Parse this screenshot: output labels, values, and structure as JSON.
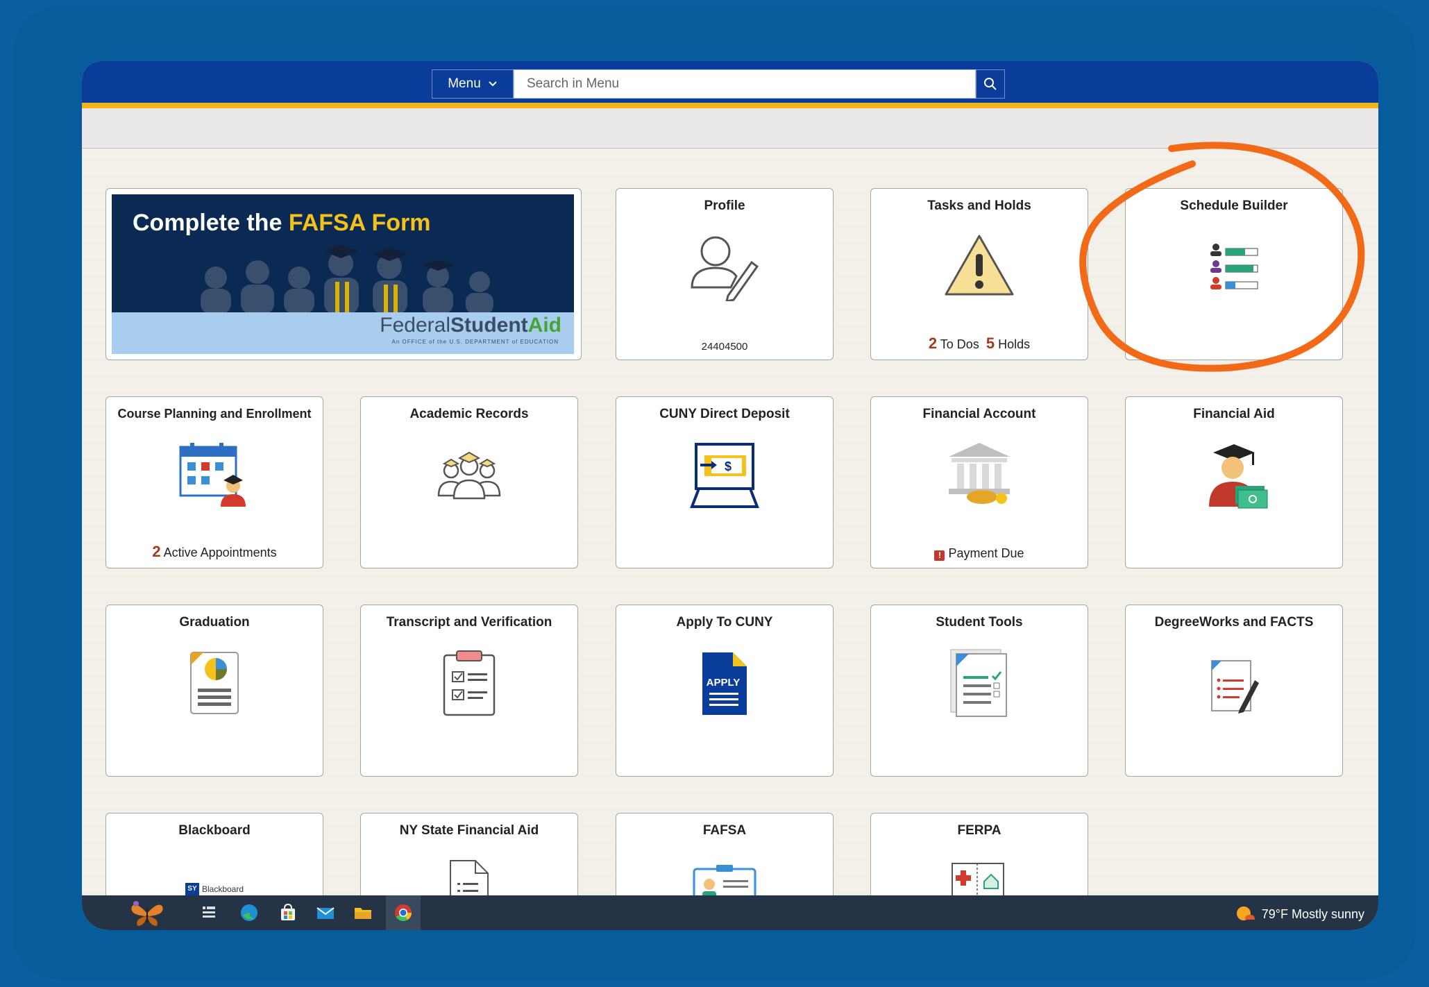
{
  "header": {
    "menu_label": "Menu",
    "search_placeholder": "Search in Menu"
  },
  "banner": {
    "headline_prefix": "Complete the ",
    "headline_highlight": "FAFSA Form",
    "brand_light": "Federal",
    "brand_bold": "Student",
    "brand_green": "Aid",
    "brand_sub": "An OFFICE of the U.S. DEPARTMENT of EDUCATION"
  },
  "tiles": {
    "profile": {
      "title": "Profile",
      "foot": "24404500",
      "icon": "user-edit-icon"
    },
    "tasks": {
      "title": "Tasks and Holds",
      "todos_count": "2",
      "todos_label": "To Dos",
      "holds_count": "5",
      "holds_label": "Holds",
      "icon": "warning-icon"
    },
    "schedule": {
      "title": "Schedule Builder",
      "icon": "schedule-list-icon"
    },
    "course": {
      "title": "Course Planning and Enrollment",
      "count": "2",
      "label": "Active Appointments",
      "icon": "calendar-student-icon"
    },
    "records": {
      "title": "Academic Records",
      "icon": "graduates-icon"
    },
    "deposit": {
      "title": "CUNY Direct Deposit",
      "icon": "laptop-deposit-icon"
    },
    "account": {
      "title": "Financial Account",
      "foot": "Payment Due",
      "icon": "bank-icon"
    },
    "aid": {
      "title": "Financial Aid",
      "icon": "graduate-money-icon"
    },
    "graduation": {
      "title": "Graduation",
      "icon": "report-chart-icon"
    },
    "transcript": {
      "title": "Transcript and Verification",
      "icon": "clipboard-check-icon"
    },
    "apply": {
      "title": "Apply To CUNY",
      "doc_text": "APPLY",
      "icon": "apply-document-icon"
    },
    "tools": {
      "title": "Student Tools",
      "icon": "checklist-document-icon"
    },
    "degreeworks": {
      "title": "DegreeWorks and FACTS",
      "icon": "document-pen-icon"
    },
    "blackboard": {
      "title": "Blackboard",
      "logo_text": "Blackboard",
      "icon": "blackboard-logo-icon"
    },
    "nysaid": {
      "title": "NY State Financial Aid",
      "icon": "document-icon"
    },
    "fafsa": {
      "title": "FAFSA",
      "icon": "id-card-icon"
    },
    "ferpa": {
      "title": "FERPA",
      "icon": "medical-house-icon"
    }
  },
  "taskbar": {
    "weather": "79°F  Mostly sunny"
  },
  "colors": {
    "nav": "#0a3c9a",
    "gold": "#f2b31c",
    "frame": "#075c9c",
    "annotation": "#f26a17"
  }
}
